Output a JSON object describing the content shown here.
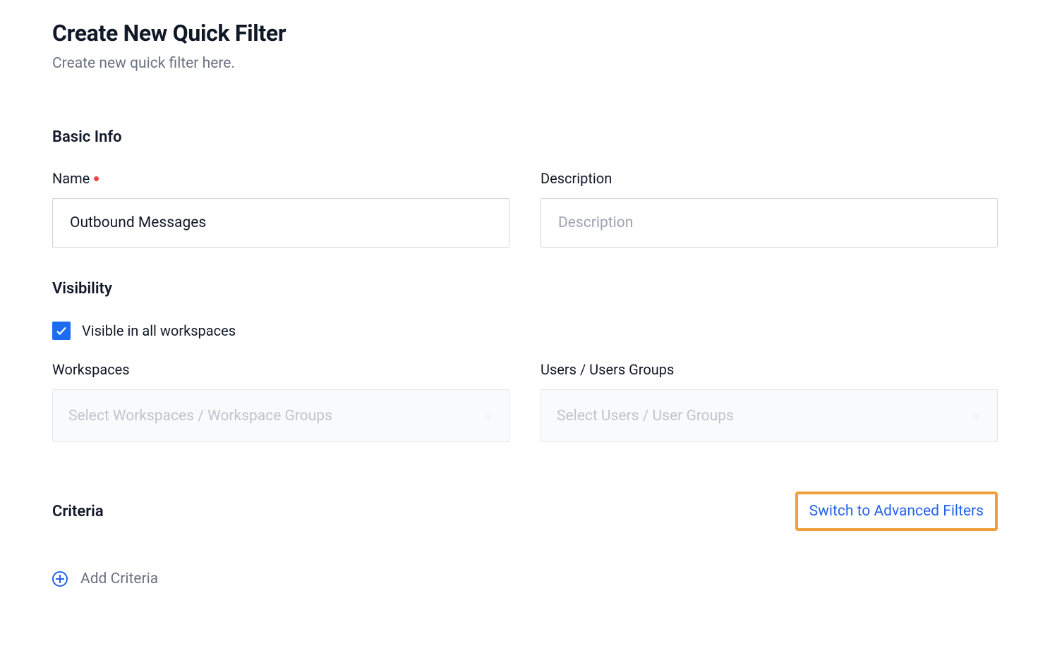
{
  "header": {
    "title": "Create New Quick Filter",
    "subtitle": "Create new quick filter here."
  },
  "sections": {
    "basic_info": {
      "title": "Basic Info",
      "name": {
        "label": "Name",
        "required": true,
        "value": "Outbound Messages"
      },
      "description": {
        "label": "Description",
        "placeholder": "Description",
        "value": ""
      }
    },
    "visibility": {
      "title": "Visibility",
      "visible_all": {
        "label": "Visible in all workspaces",
        "checked": true
      },
      "workspaces": {
        "label": "Workspaces",
        "placeholder": "Select Workspaces / Workspace Groups",
        "disabled": true
      },
      "users": {
        "label": "Users / Users Groups",
        "placeholder": "Select Users / User Groups",
        "disabled": true
      }
    },
    "criteria": {
      "title": "Criteria",
      "switch_link": "Switch to Advanced Filters",
      "add_label": "Add Criteria"
    }
  }
}
